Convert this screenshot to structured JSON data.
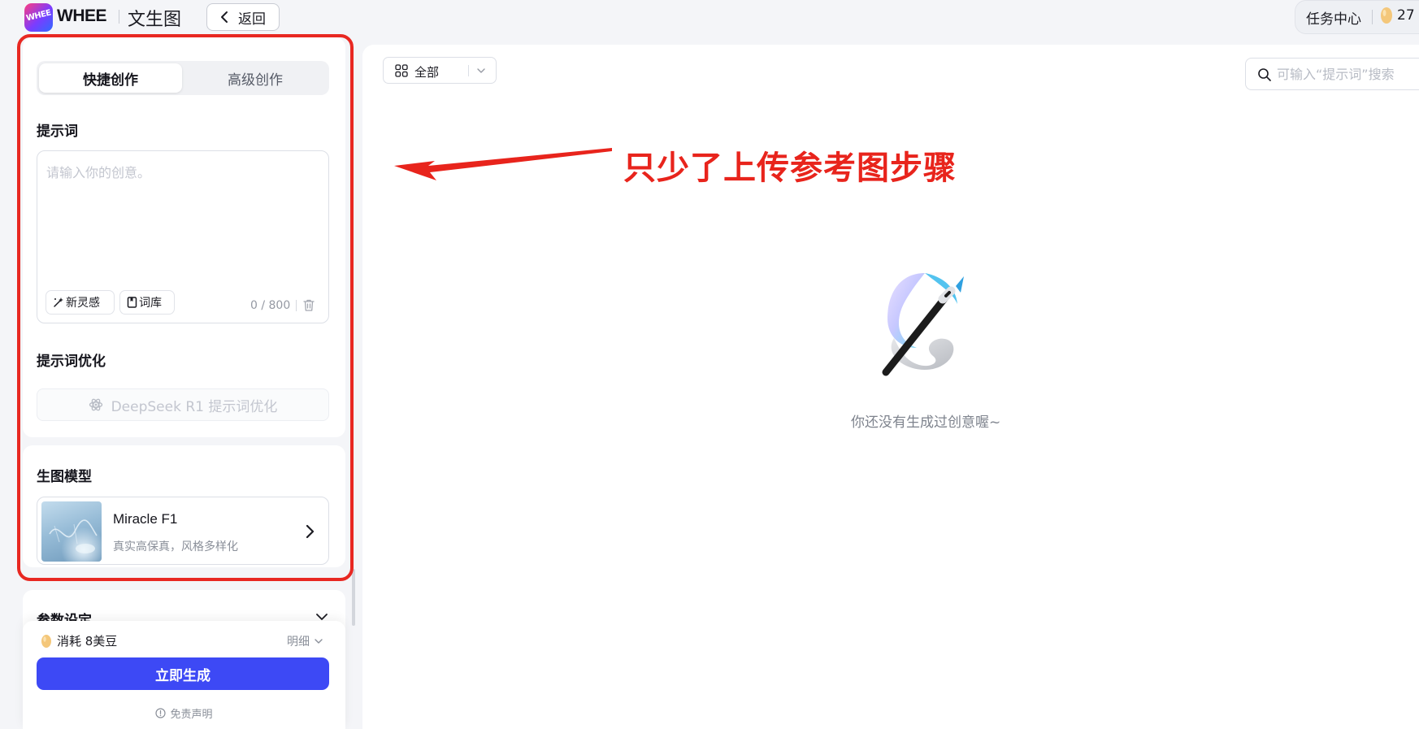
{
  "header": {
    "logo_text": "WHEE",
    "brand": "WHEE",
    "page_title": "文生图",
    "back_label": "返回",
    "task_center": "任务中心",
    "beans": "27"
  },
  "sidebar": {
    "tabs": [
      {
        "label": "快捷创作",
        "active": true
      },
      {
        "label": "高级创作",
        "active": false
      }
    ],
    "prompt": {
      "title": "提示词",
      "placeholder": "请输入你的创意。",
      "inspire_label": "新灵感",
      "library_label": "词库",
      "counter": "0 / 800"
    },
    "optimize": {
      "title": "提示词优化",
      "button_label": "DeepSeek R1 提示词优化"
    },
    "model": {
      "title": "生图模型",
      "name": "Miracle F1",
      "desc": "真实高保真，风格多样化"
    },
    "params": {
      "title": "参数设定"
    },
    "footer": {
      "cost": "消耗 8美豆",
      "detail": "明细",
      "generate": "立即生成",
      "disclaimer": "免责声明"
    }
  },
  "main": {
    "filter_label": "全部",
    "search_placeholder": "可输入“提示词”搜索",
    "empty_text": "你还没有生成过创意喔~"
  },
  "annotation": {
    "text": "只少了上传参考图步骤",
    "color": "#e8241c"
  },
  "colors": {
    "primary": "#3d49f5",
    "annotation_red": "#e82822"
  }
}
